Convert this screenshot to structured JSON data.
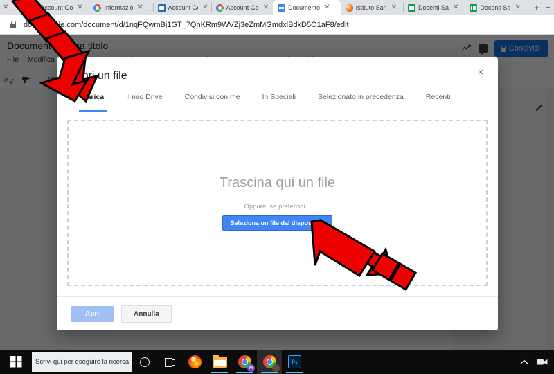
{
  "browser": {
    "tabs": [
      {
        "title": "Account Go",
        "icon": "google-icon",
        "active": false,
        "partial": true
      },
      {
        "title": "Account Go",
        "icon": "google-icon",
        "active": false
      },
      {
        "title": "Informazio",
        "icon": "info-page-icon",
        "active": false
      },
      {
        "title": "Account Go",
        "icon": "google-icon",
        "active": false
      },
      {
        "title": "Documento",
        "icon": "google-docs-icon",
        "active": true
      },
      {
        "title": "Istituto San",
        "icon": "site-icon",
        "active": false
      },
      {
        "title": "Docenti Sa",
        "icon": "google-sheets-icon",
        "active": false
      },
      {
        "title": "Docenti Sa",
        "icon": "google-sheets-icon",
        "active": false
      }
    ],
    "new_tab_label": "+",
    "close_label": "✕",
    "window_minimize": "–",
    "url": "docs.google.com/document/d/1nqFQwmBj1GT_7QnKRm9WVZj3eZmMGmdxlBdkD5O1aF8/edit",
    "lock_icon": "lock-icon"
  },
  "docs": {
    "document_title": "Documento senza titolo",
    "menu": [
      "File",
      "Modifica",
      "Visualizza",
      "Inserisci",
      "Formato",
      "Strumenti",
      "Componenti aggiuntivi",
      "Guida"
    ],
    "share_label": "Condividi",
    "share_icon": "lock-icon",
    "activity_icon": "trending-up-icon",
    "comment_icon": "comment-icon",
    "edit_mode_icon": "pencil-icon",
    "toolbar_zoom": "100%",
    "toolbar_items": [
      "spelling-icon",
      "paint-format-icon"
    ]
  },
  "dialog": {
    "title": "Apri un file",
    "close_label": "×",
    "tabs": [
      {
        "label": "Carica",
        "selected": true
      },
      {
        "label": "Il mio Drive",
        "selected": false
      },
      {
        "label": "Condivisi con me",
        "selected": false
      },
      {
        "label": "In Speciali",
        "selected": false
      },
      {
        "label": "Selezionato in precedenza",
        "selected": false
      },
      {
        "label": "Recenti",
        "selected": false
      }
    ],
    "dropzone": {
      "headline": "Trascina qui un file",
      "subtext": "Oppure, se preferisci...",
      "button_label": "Seleziona un file dal dispositivo"
    },
    "footer": {
      "confirm_label": "Apri",
      "cancel_label": "Annulla"
    }
  },
  "annotations": {
    "arrow_color": "#ee0000",
    "arrow_outline": "#000000",
    "arrows": [
      {
        "name": "arrow-pointing-to-dialog-title",
        "direction": "down-right"
      },
      {
        "name": "arrow-pointing-to-select-file-button",
        "direction": "up-left"
      }
    ]
  },
  "taskbar": {
    "search_placeholder": "Scrivi qui per eseguire la ricerca",
    "cortana_icon": "cortana-circle-icon",
    "task_view_icon": "task-view-icon",
    "items": [
      {
        "name": "firefox",
        "icon": "firefox-icon",
        "running": false
      },
      {
        "name": "file-explorer",
        "icon": "folder-icon",
        "running": true
      },
      {
        "name": "chrome",
        "icon": "chrome-icon",
        "running": true
      },
      {
        "name": "chrome-profile",
        "icon": "chrome-icon",
        "running": true,
        "active": true
      },
      {
        "name": "photoshop",
        "icon": "photoshop-icon",
        "running": true
      }
    ],
    "tray": {
      "chevron_icon": "chevron-up-icon",
      "camera_icon": "camera-icon"
    }
  }
}
